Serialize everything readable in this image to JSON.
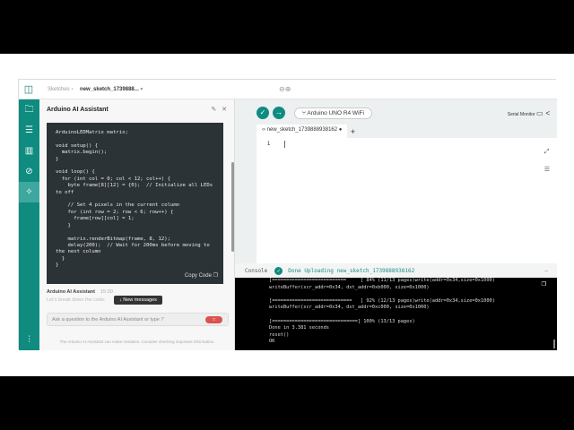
{
  "breadcrumb": {
    "root": "Sketches",
    "sketch": "new_sketch_1739888..."
  },
  "assistant": {
    "title": "Arduino AI Assistant",
    "code": "ArduinoLEDMatrix matrix;\n\nvoid setup() {\n  matrix.begin();\n}\n\nvoid loop() {\n  for (int col = 0; col < 12; col++) {\n    byte frame[8][12] = {0};  // Initialize all LEDs to off\n\n    // Set 4 pixels in the current column\n    for (int row = 2; row < 6; row++) {\n      frame[row][col] = 1;\n    }\n\n    matrix.renderBitmap(frame, 8, 12);\n    delay(200);  // Wait for 200ms before moving to the next column\n  }\n}",
    "copy_label": "Copy Code",
    "sender": "Arduino AI Assistant",
    "time": "15:30",
    "message": "Let's break down the code:",
    "new_messages": "New messages",
    "ask_placeholder": "Ask a question to the Arduino AI Assistant or type '/'",
    "disclaimer": "The Arduino AI Assistant can make mistakes. Consider checking important information."
  },
  "toolbar": {
    "board": "Arduino UNO R4 WiFi",
    "serial_monitor": "Serial Monitor"
  },
  "tab": {
    "name": "new_sketch_1739888938162",
    "line": "1"
  },
  "console": {
    "label": "Console",
    "status": "Done Uploading new_sketch_1739888938162",
    "output": "[==========================     ] 84% (11/13 pages)write(addr=0x34,size=0x1000)\nwriteBuffer(scr_addr=0x34, dst_addr=0xb000, size=0x1000)\n\n[============================   ] 92% (12/13 pages)write(addr=0x34,size=0x1000)\nwriteBuffer(scr_addr=0x34, dst_addr=0xc000, size=0x1000)\n\n[==============================] 100% (13/13 pages)\nDone in 3.381 seconds\nreset()\nOK"
  }
}
